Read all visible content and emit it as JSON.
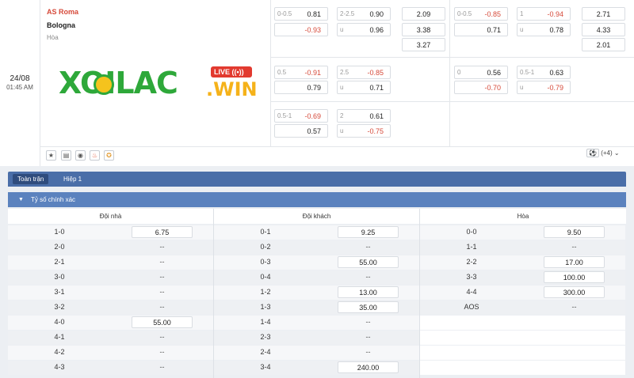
{
  "match": {
    "date": "24/08",
    "time": "01:45 AM",
    "home": "AS Roma",
    "away": "Bologna",
    "draw": "Hòa"
  },
  "odds": {
    "r1": {
      "hcap": {
        "line": "0-0.5",
        "home": "0.81",
        "away": "-0.93"
      },
      "ou": {
        "line": "2-2.5",
        "over": "0.90",
        "u": "u",
        "under": "0.96"
      },
      "x12": [
        "2.09",
        "3.38",
        "3.27"
      ],
      "hcap_h": {
        "line": "0-0.5",
        "home": "-0.85",
        "away": "0.71"
      },
      "ou_h": {
        "line": "1",
        "over": "-0.94",
        "u": "u",
        "under": "0.78"
      },
      "x12_h": [
        "2.71",
        "4.33",
        "2.01"
      ]
    },
    "r2": {
      "hcap": {
        "line": "0.5",
        "home": "-0.91",
        "away": "0.79"
      },
      "ou": {
        "line": "2.5",
        "over": "-0.85",
        "u": "u",
        "under": "0.71"
      },
      "hcap_h": {
        "line": "0",
        "home": "0.56",
        "away": "-0.70"
      },
      "ou_h": {
        "line": "0.5-1",
        "over": "0.63",
        "u": "u",
        "under": "-0.79"
      }
    },
    "r3": {
      "hcap": {
        "line": "0.5-1",
        "home": "-0.69",
        "away": "0.57"
      },
      "ou": {
        "line": "2",
        "over": "0.61",
        "u": "u",
        "under": "-0.75"
      }
    }
  },
  "logo": {
    "main": "XOILAC",
    "live": "LIVE ((•))",
    "win": ".WIN"
  },
  "icons": [
    "star-icon",
    "bus-icon",
    "eye-icon",
    "fire-icon",
    "medal-icon"
  ],
  "more_label": "(+4)",
  "tabs": [
    "Toàn trận",
    "Hiệp 1"
  ],
  "section_title": "Tỷ số chính xác",
  "columns": [
    "Đội nhà",
    "Đội khách",
    "Hòa"
  ],
  "home_rows": [
    {
      "score": "1-0",
      "odd": "6.75"
    },
    {
      "score": "2-0",
      "odd": "--"
    },
    {
      "score": "2-1",
      "odd": "--"
    },
    {
      "score": "3-0",
      "odd": "--"
    },
    {
      "score": "3-1",
      "odd": "--"
    },
    {
      "score": "3-2",
      "odd": "--"
    },
    {
      "score": "4-0",
      "odd": "55.00"
    },
    {
      "score": "4-1",
      "odd": "--"
    },
    {
      "score": "4-2",
      "odd": "--"
    },
    {
      "score": "4-3",
      "odd": "--"
    }
  ],
  "away_rows": [
    {
      "score": "0-1",
      "odd": "9.25"
    },
    {
      "score": "0-2",
      "odd": "--"
    },
    {
      "score": "0-3",
      "odd": "55.00"
    },
    {
      "score": "0-4",
      "odd": "--"
    },
    {
      "score": "1-2",
      "odd": "13.00"
    },
    {
      "score": "1-3",
      "odd": "35.00"
    },
    {
      "score": "1-4",
      "odd": "--"
    },
    {
      "score": "2-3",
      "odd": "--"
    },
    {
      "score": "2-4",
      "odd": "--"
    },
    {
      "score": "3-4",
      "odd": "240.00"
    }
  ],
  "draw_rows": [
    {
      "score": "0-0",
      "odd": "9.50"
    },
    {
      "score": "1-1",
      "odd": "--"
    },
    {
      "score": "2-2",
      "odd": "17.00"
    },
    {
      "score": "3-3",
      "odd": "100.00"
    },
    {
      "score": "4-4",
      "odd": "300.00"
    },
    {
      "score": "AOS",
      "odd": "--"
    }
  ]
}
